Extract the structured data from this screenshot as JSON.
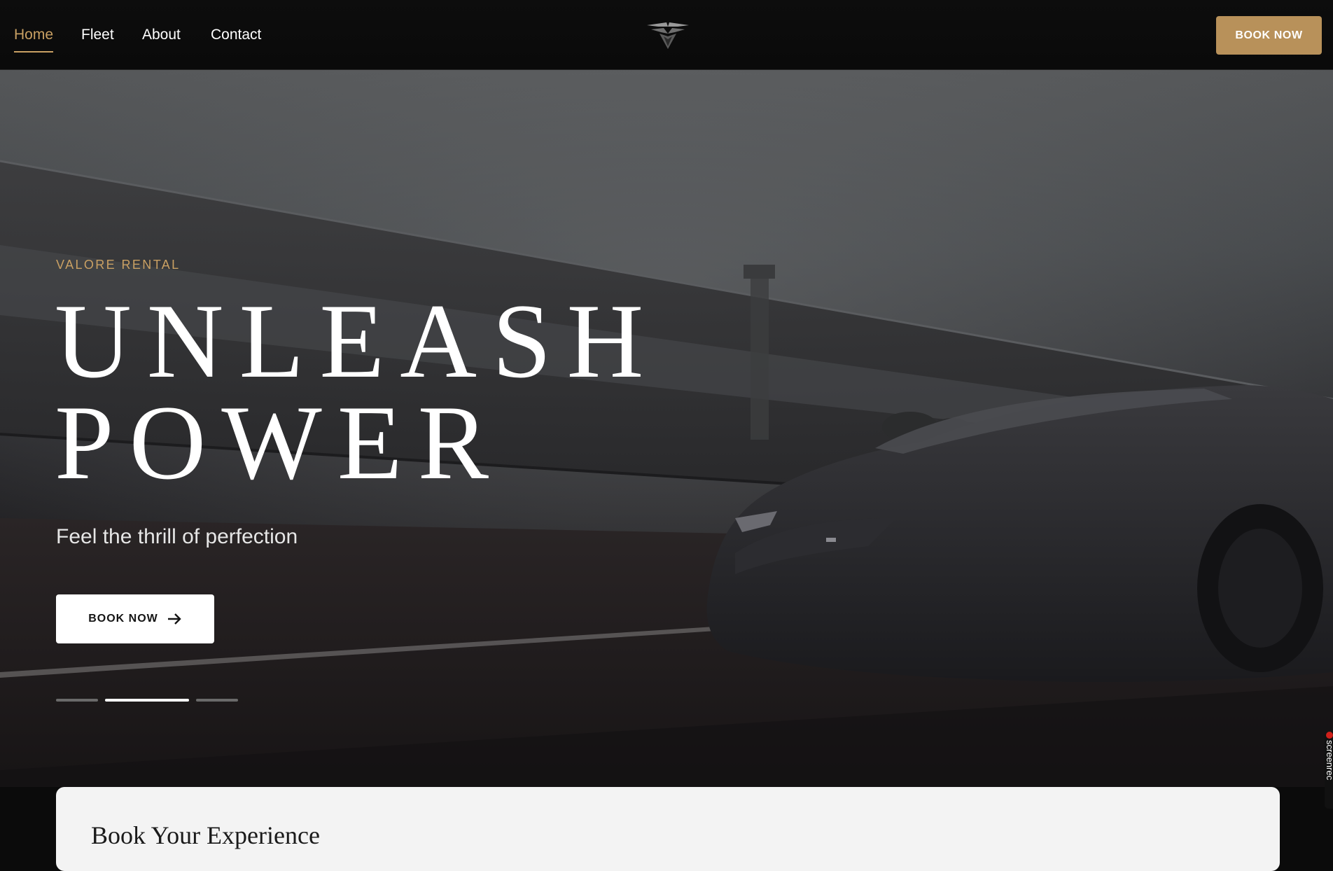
{
  "nav": {
    "links": [
      {
        "label": "Home",
        "active": true
      },
      {
        "label": "Fleet",
        "active": false
      },
      {
        "label": "About",
        "active": false
      },
      {
        "label": "Contact",
        "active": false
      }
    ],
    "logo_icon": "winged-emblem-logo",
    "book_label": "BOOK NOW"
  },
  "hero": {
    "eyebrow": "VALORE RENTAL",
    "headline_line1": "UNLEASH",
    "headline_line2": "POWER",
    "subline": "Feel the thrill of perfection",
    "cta_label": "BOOK NOW",
    "cta_icon": "arrow-right-icon",
    "slides": {
      "count": 3,
      "active_index": 1
    }
  },
  "booking": {
    "title": "Book Your Experience"
  },
  "side_widget": {
    "label": "screenrec"
  },
  "colors": {
    "accent": "#c9a063",
    "button_gold": "#b8915a",
    "nav_bg": "#0b0b0b",
    "card_bg": "#f3f3f3"
  }
}
